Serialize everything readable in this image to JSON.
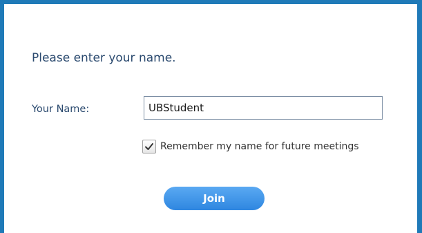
{
  "dialog": {
    "prompt": "Please enter your name.",
    "name_label": "Your Name:",
    "name_value": "UBStudent",
    "remember_label": "Remember my name for future meetings",
    "remember_checked": true,
    "join_label": "Join"
  },
  "colors": {
    "frame_border": "#1f7ab8",
    "label_text": "#2b4a6f",
    "join_button": "#2e86e0"
  },
  "icons": {
    "remember_checkbox": "checkmark-icon"
  }
}
